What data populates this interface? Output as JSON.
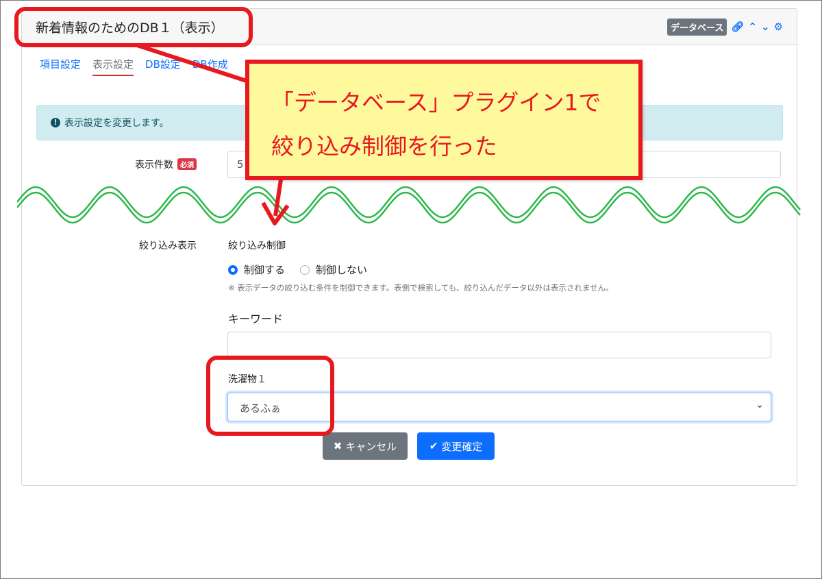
{
  "card": {
    "title": "新着情報のためのDB１（表示）",
    "badge": "データベース"
  },
  "tabs": [
    {
      "label": "項目設定",
      "active": false
    },
    {
      "label": "表示設定",
      "active": true
    },
    {
      "label": "DB設定",
      "active": false
    },
    {
      "label": "DB作成",
      "active": false
    }
  ],
  "alert": {
    "text": "表示設定を変更します。"
  },
  "display_count": {
    "label": "表示件数",
    "required_badge": "必須",
    "value": "5"
  },
  "filter": {
    "section_label": "絞り込み表示",
    "control_label": "絞り込み制御",
    "options": [
      {
        "label": "制御する",
        "checked": true
      },
      {
        "label": "制御しない",
        "checked": false
      }
    ],
    "help": "※ 表示データの絞り込む条件を制御できます。表側で検索しても、絞り込んだデータ以外は表示されません。"
  },
  "keyword": {
    "label": "キーワード",
    "value": ""
  },
  "laundry": {
    "label": "洗濯物１",
    "selected": "あるふぁ"
  },
  "buttons": {
    "cancel": "キャンセル",
    "confirm": "変更確定"
  },
  "callout": {
    "line1": "「データベース」プラグイン1で",
    "line2": "絞り込み制御を行った"
  },
  "colors": {
    "annotation_red": "#e8181f",
    "callout_bg": "#fff99e",
    "wave_green": "#2db84a",
    "primary": "#0d6efd"
  }
}
